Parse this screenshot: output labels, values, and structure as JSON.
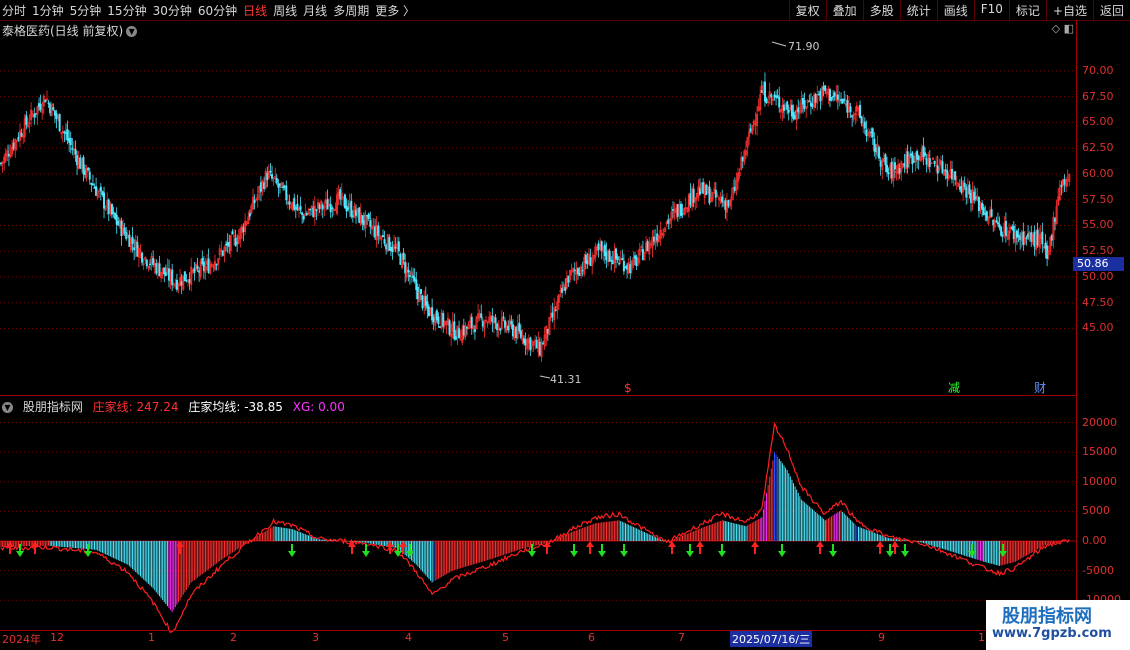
{
  "toolbar": {
    "periods": [
      "分时",
      "1分钟",
      "5分钟",
      "15分钟",
      "30分钟",
      "60分钟",
      "日线",
      "周线",
      "月线",
      "多周期",
      "更多 〉"
    ],
    "active_period": "日线",
    "tools": [
      "复权",
      "叠加",
      "多股",
      "统计",
      "画线",
      "F10",
      "标记",
      "+自选",
      "返回"
    ]
  },
  "main": {
    "title": "泰格医药(日线 前复权)",
    "current_price": "50.86",
    "high_label": "71.90",
    "low_label": "41.31",
    "markers": [
      {
        "text": "$",
        "color": "#ff3030"
      },
      {
        "text": "减",
        "color": "#30ff30"
      },
      {
        "text": "财",
        "color": "#6090ff"
      }
    ],
    "price_ticks": [
      "70.00",
      "67.50",
      "65.00",
      "62.50",
      "60.00",
      "57.50",
      "55.00",
      "52.50",
      "50.00",
      "47.50",
      "45.00"
    ]
  },
  "indicator": {
    "name": "股朋指标网",
    "line1": "庄家线: 247.24",
    "line2": "庄家均线: -38.85",
    "line3": "XG: 0.00",
    "ticks": [
      "20000",
      "15000",
      "10000",
      "5000",
      "0.00",
      "-5000",
      "-10000"
    ]
  },
  "date_axis": [
    "2024年",
    "12",
    "1",
    "2",
    "3",
    "4",
    "5",
    "6",
    "7",
    "2025/07/16/三",
    "9",
    "1"
  ],
  "watermark": {
    "line1": "股朋指标网",
    "line2": "www.7gpzb.com"
  },
  "colors": {
    "up": "#ff3030",
    "down": "#4fe8ff",
    "grid": "#7a0000",
    "blue": "#1c2fa0",
    "magenta": "#ff30ff"
  },
  "chart_data": {
    "type": "candlestick",
    "price_range": [
      40,
      73
    ],
    "close_waypoints": [
      [
        0,
        61
      ],
      [
        12,
        64
      ],
      [
        28,
        67.5
      ],
      [
        50,
        61
      ],
      [
        72,
        55.5
      ],
      [
        90,
        52
      ],
      [
        110,
        49.5
      ],
      [
        130,
        51
      ],
      [
        150,
        54
      ],
      [
        168,
        60
      ],
      [
        190,
        56
      ],
      [
        214,
        57.5
      ],
      [
        232,
        55
      ],
      [
        250,
        52.5
      ],
      [
        268,
        47
      ],
      [
        288,
        44.5
      ],
      [
        305,
        46
      ],
      [
        322,
        45
      ],
      [
        340,
        43
      ],
      [
        358,
        50
      ],
      [
        378,
        52.5
      ],
      [
        398,
        51
      ],
      [
        418,
        55
      ],
      [
        440,
        58.5
      ],
      [
        460,
        57
      ],
      [
        480,
        68
      ],
      [
        500,
        66
      ],
      [
        520,
        68
      ],
      [
        540,
        66
      ],
      [
        560,
        60
      ],
      [
        578,
        62
      ],
      [
        600,
        60
      ],
      [
        612,
        58
      ],
      [
        628,
        55
      ],
      [
        642,
        54
      ],
      [
        656,
        53.5
      ],
      [
        660,
        51.5
      ],
      [
        668,
        59
      ],
      [
        674,
        59.5
      ]
    ],
    "osc_waypoints": [
      [
        0,
        -1000
      ],
      [
        30,
        -800
      ],
      [
        60,
        -1500
      ],
      [
        80,
        -4000
      ],
      [
        96,
        -8000
      ],
      [
        108,
        -12000
      ],
      [
        120,
        -7000
      ],
      [
        140,
        -3000
      ],
      [
        160,
        500
      ],
      [
        172,
        2500
      ],
      [
        184,
        2000
      ],
      [
        200,
        300
      ],
      [
        230,
        -300
      ],
      [
        250,
        -1200
      ],
      [
        262,
        -4000
      ],
      [
        272,
        -7000
      ],
      [
        285,
        -5000
      ],
      [
        310,
        -3000
      ],
      [
        330,
        -1200
      ],
      [
        345,
        -300
      ],
      [
        360,
        1500
      ],
      [
        375,
        3000
      ],
      [
        390,
        3500
      ],
      [
        402,
        2000
      ],
      [
        420,
        -200
      ],
      [
        440,
        2000
      ],
      [
        455,
        3500
      ],
      [
        470,
        2500
      ],
      [
        480,
        4000
      ],
      [
        488,
        15000
      ],
      [
        496,
        12000
      ],
      [
        505,
        7000
      ],
      [
        520,
        3500
      ],
      [
        530,
        5200
      ],
      [
        540,
        2500
      ],
      [
        560,
        500
      ],
      [
        580,
        -200
      ],
      [
        600,
        -1800
      ],
      [
        620,
        -3500
      ],
      [
        630,
        -4200
      ],
      [
        640,
        -3500
      ],
      [
        660,
        -500
      ],
      [
        674,
        0
      ]
    ],
    "up_arrow_x": [
      10,
      35,
      180,
      352,
      390,
      403,
      547,
      590,
      672,
      700,
      755,
      820,
      880,
      895
    ],
    "down_arrow_x": [
      20,
      88,
      292,
      366,
      398,
      410,
      532,
      574,
      602,
      624,
      690,
      722,
      782,
      833,
      890,
      905,
      972,
      1003
    ]
  }
}
